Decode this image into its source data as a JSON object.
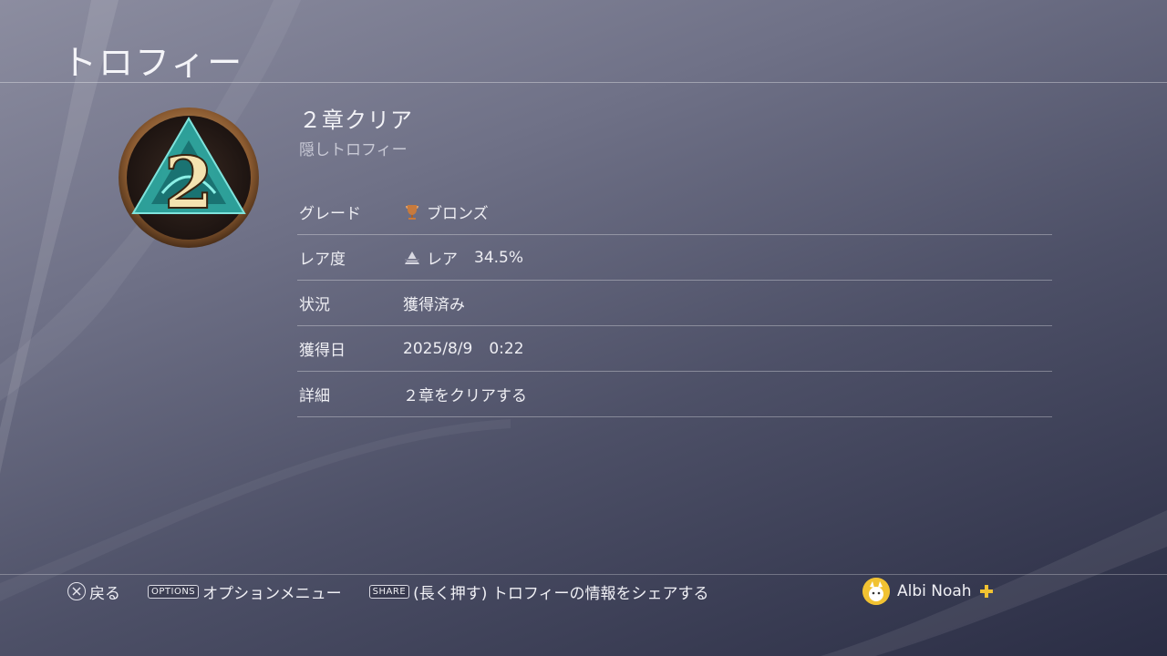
{
  "header": {
    "title": "トロフィー"
  },
  "trophy": {
    "name": "２章クリア",
    "subtitle": "隠しトロフィー",
    "icon_numeral": "2"
  },
  "details": {
    "grade": {
      "label": "グレード",
      "value": "ブロンズ",
      "icon": "bronze-trophy-icon"
    },
    "rarity": {
      "label": "レア度",
      "value": "レア",
      "percent": "34.5%",
      "icon": "rarity-pyramid-icon"
    },
    "status": {
      "label": "状況",
      "value": "獲得済み"
    },
    "earned": {
      "label": "獲得日",
      "date": "2025/8/9",
      "time": "0:22"
    },
    "description": {
      "label": "詳細",
      "value": "２章をクリアする"
    }
  },
  "footer": {
    "back_label": "戻る",
    "options_key": "OPTIONS",
    "options_label": "オプションメニュー",
    "share_key": "SHARE",
    "share_label": "(長く押す) トロフィーの情報をシェアする",
    "user_name": "Albi Noah"
  },
  "colors": {
    "accent_gold": "#f1c232",
    "bronze": "#c77a3d",
    "teal": "#2fb7b0"
  }
}
